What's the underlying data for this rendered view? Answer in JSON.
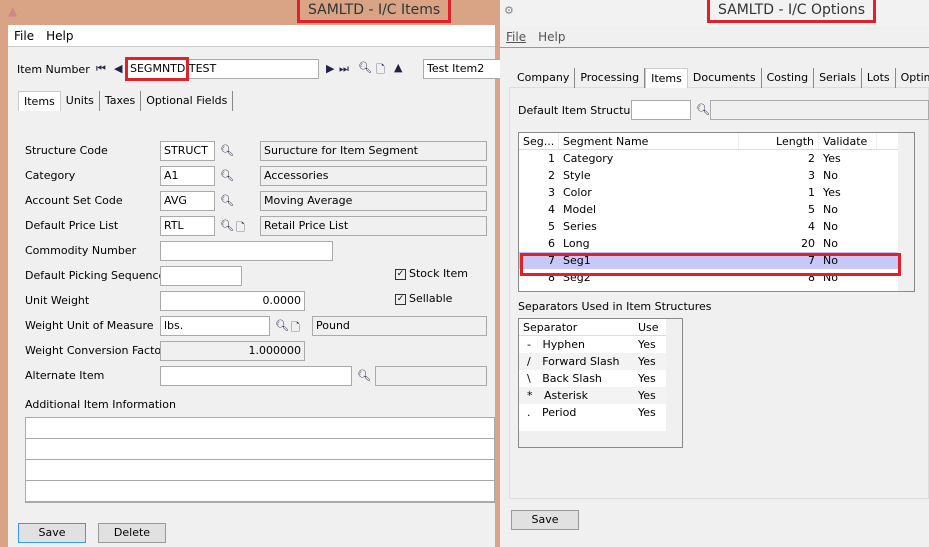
{
  "items_window": {
    "title": "SAMLTD - I/C Items",
    "menu": [
      "File",
      "Help"
    ],
    "item_number_label": "Item Number",
    "item_number_prefix": "SEGMNTD",
    "item_number_rest": " TEST",
    "item_description": "Test Item2",
    "tabs": [
      "Items",
      "Units",
      "Taxes",
      "Optional Fields"
    ],
    "fields": [
      {
        "label": "Structure Code",
        "value": "STRUCT",
        "desc": "Suructure for Item Segment"
      },
      {
        "label": "Category",
        "value": "A1",
        "desc": "Accessories"
      },
      {
        "label": "Account Set Code",
        "value": "AVG",
        "desc": "Moving Average"
      },
      {
        "label": "Default Price List",
        "value": "RTL",
        "desc": "Retail Price List"
      },
      {
        "label": "Commodity Number",
        "value": ""
      },
      {
        "label": "Default Picking Sequence",
        "value": ""
      },
      {
        "label": "Unit Weight",
        "value": "0.0000"
      },
      {
        "label": "Weight Unit of Measure",
        "value": "lbs.",
        "desc": "Pound"
      },
      {
        "label": "Weight Conversion Factor",
        "value": "1.000000"
      },
      {
        "label": "Alternate Item",
        "value": ""
      }
    ],
    "stock_item_label": "Stock Item",
    "stock_item_checked": true,
    "sellable_label": "Sellable",
    "sellable_checked": true,
    "additional_info_label": "Additional Item Information",
    "save_label": "Save",
    "delete_label": "Delete"
  },
  "options_window": {
    "title": "SAMLTD - I/C Options",
    "menu": [
      "File",
      "Help"
    ],
    "tabs": [
      "Company",
      "Processing",
      "Items",
      "Documents",
      "Costing",
      "Serials",
      "Lots",
      "Optimizer"
    ],
    "default_structure_label": "Default Item Structure",
    "segments_headers": [
      "Seg...",
      "Segment Name",
      "Length",
      "Validate"
    ],
    "segments": [
      [
        "1",
        "Category",
        "2",
        "Yes"
      ],
      [
        "2",
        "Style",
        "3",
        "No"
      ],
      [
        "3",
        "Color",
        "1",
        "Yes"
      ],
      [
        "4",
        "Model",
        "5",
        "No"
      ],
      [
        "5",
        "Series",
        "4",
        "No"
      ],
      [
        "6",
        "Long",
        "20",
        "No"
      ],
      [
        "7",
        "Seg1",
        "7",
        "No"
      ],
      [
        "8",
        "Seg2",
        "8",
        "No"
      ]
    ],
    "separators_label": "Separators Used in Item Structures",
    "separators_headers": [
      "Separator",
      "Use"
    ],
    "separators": [
      [
        "-",
        "Hyphen",
        "Yes"
      ],
      [
        "/",
        "Forward Slash",
        "Yes"
      ],
      [
        "\\",
        "Back Slash",
        "Yes"
      ],
      [
        "*",
        "Asterisk",
        "Yes"
      ],
      [
        ".",
        "Period",
        "Yes"
      ]
    ],
    "save_label": "Save"
  }
}
